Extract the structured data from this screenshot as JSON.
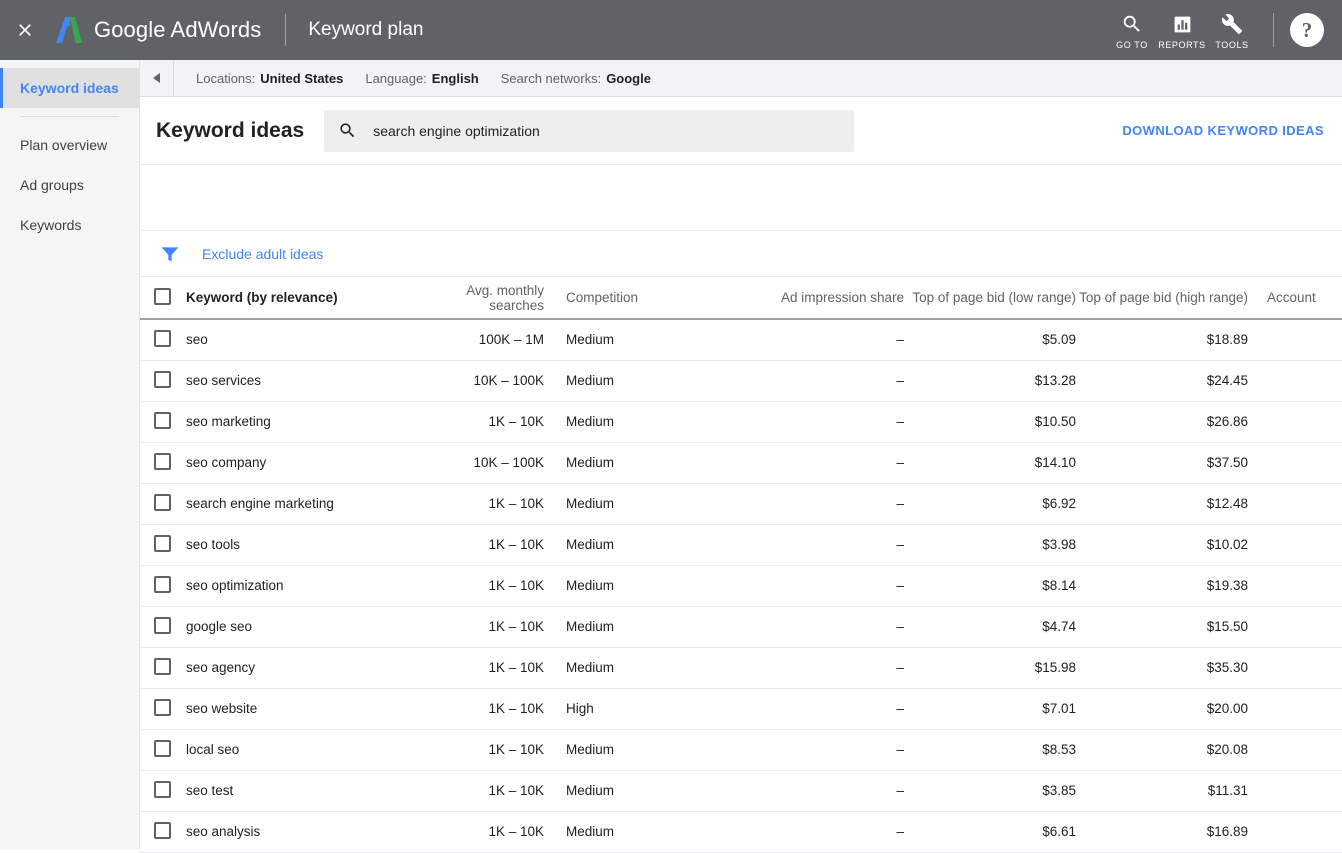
{
  "appbar": {
    "close_icon": "close-icon",
    "brand_name": "Google AdWords",
    "page_title": "Keyword plan",
    "tools": [
      {
        "icon": "search-icon",
        "label": "GO TO"
      },
      {
        "icon": "bar-chart-icon",
        "label": "REPORTS"
      },
      {
        "icon": "wrench-icon",
        "label": "TOOLS"
      }
    ],
    "help_label": "?"
  },
  "sidebar": {
    "items": [
      {
        "label": "Keyword ideas",
        "active": true
      },
      {
        "label": "Plan overview",
        "active": false
      },
      {
        "label": "Ad groups",
        "active": false
      },
      {
        "label": "Keywords",
        "active": false
      }
    ]
  },
  "filterbar": {
    "collapse_icon": "collapse-left-icon",
    "chips": [
      {
        "label": "Locations:",
        "value": "United States"
      },
      {
        "label": "Language:",
        "value": "English"
      },
      {
        "label": "Search networks:",
        "value": "Google"
      }
    ]
  },
  "search": {
    "title": "Keyword ideas",
    "icon": "search-icon",
    "value": "search engine optimization",
    "placeholder": "search engine optimization",
    "download_label": "DOWNLOAD KEYWORD IDEAS"
  },
  "filters": {
    "funnel_icon": "funnel-icon",
    "exclude_label": "Exclude adult ideas"
  },
  "table": {
    "columns": [
      "Keyword (by relevance)",
      "Avg. monthly searches",
      "Competition",
      "Ad impression share",
      "Top of page bid (low range)",
      "Top of page bid (high range)",
      "Account"
    ],
    "rows": [
      {
        "keyword": "seo",
        "volume": "100K – 1M",
        "competition": "Medium",
        "impression_share": "–",
        "bid_low": "$5.09",
        "bid_high": "$18.89",
        "account": ""
      },
      {
        "keyword": "seo services",
        "volume": "10K – 100K",
        "competition": "Medium",
        "impression_share": "–",
        "bid_low": "$13.28",
        "bid_high": "$24.45",
        "account": ""
      },
      {
        "keyword": "seo marketing",
        "volume": "1K – 10K",
        "competition": "Medium",
        "impression_share": "–",
        "bid_low": "$10.50",
        "bid_high": "$26.86",
        "account": ""
      },
      {
        "keyword": "seo company",
        "volume": "10K – 100K",
        "competition": "Medium",
        "impression_share": "–",
        "bid_low": "$14.10",
        "bid_high": "$37.50",
        "account": ""
      },
      {
        "keyword": "search engine marketing",
        "volume": "1K – 10K",
        "competition": "Medium",
        "impression_share": "–",
        "bid_low": "$6.92",
        "bid_high": "$12.48",
        "account": ""
      },
      {
        "keyword": "seo tools",
        "volume": "1K – 10K",
        "competition": "Medium",
        "impression_share": "–",
        "bid_low": "$3.98",
        "bid_high": "$10.02",
        "account": ""
      },
      {
        "keyword": "seo optimization",
        "volume": "1K – 10K",
        "competition": "Medium",
        "impression_share": "–",
        "bid_low": "$8.14",
        "bid_high": "$19.38",
        "account": ""
      },
      {
        "keyword": "google seo",
        "volume": "1K – 10K",
        "competition": "Medium",
        "impression_share": "–",
        "bid_low": "$4.74",
        "bid_high": "$15.50",
        "account": ""
      },
      {
        "keyword": "seo agency",
        "volume": "1K – 10K",
        "competition": "Medium",
        "impression_share": "–",
        "bid_low": "$15.98",
        "bid_high": "$35.30",
        "account": ""
      },
      {
        "keyword": "seo website",
        "volume": "1K – 10K",
        "competition": "High",
        "impression_share": "–",
        "bid_low": "$7.01",
        "bid_high": "$20.00",
        "account": ""
      },
      {
        "keyword": "local seo",
        "volume": "1K – 10K",
        "competition": "Medium",
        "impression_share": "–",
        "bid_low": "$8.53",
        "bid_high": "$20.08",
        "account": ""
      },
      {
        "keyword": "seo test",
        "volume": "1K – 10K",
        "competition": "Medium",
        "impression_share": "–",
        "bid_low": "$3.85",
        "bid_high": "$11.31",
        "account": ""
      },
      {
        "keyword": "seo analysis",
        "volume": "1K – 10K",
        "competition": "Medium",
        "impression_share": "–",
        "bid_low": "$6.61",
        "bid_high": "$16.89",
        "account": ""
      }
    ]
  },
  "colors": {
    "appbar_bg": "#5f6368",
    "accent_blue": "#4285f4",
    "logo_blue": "#4285f4",
    "logo_green": "#34a853",
    "sidebar_bg": "#f5f5f5",
    "filterbar_bg": "#f1f3f4",
    "searchbox_bg": "#eeeeee"
  }
}
